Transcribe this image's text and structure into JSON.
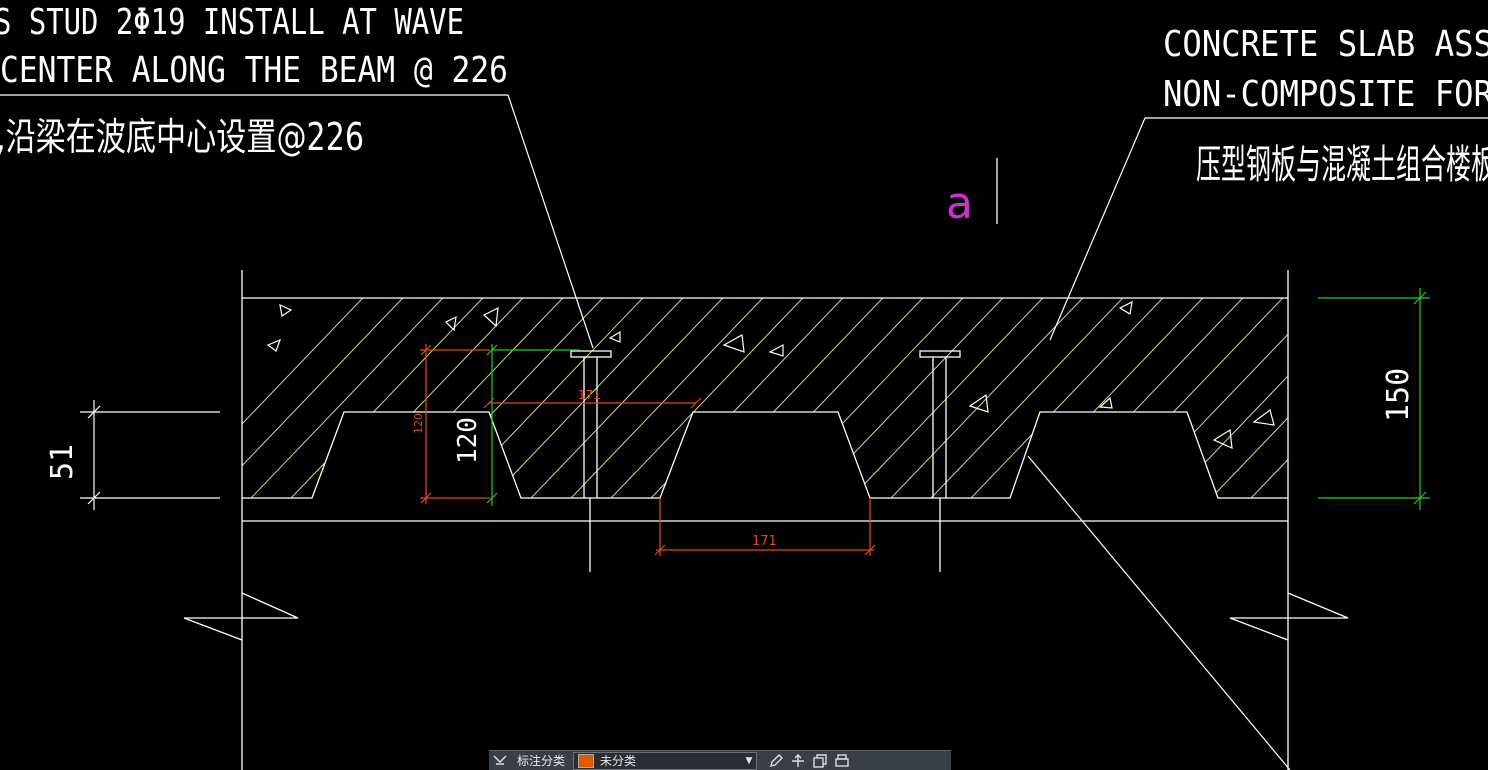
{
  "annotations": {
    "stud_en_line1": "S STUD 2Φ19 INSTALL AT WAVE",
    "stud_en_line2": "CENTER ALONG THE BEAM @ 226",
    "stud_cn": ",沿梁在波底中心设置@226",
    "slab_en_line1": "CONCRETE SLAB ASS",
    "slab_en_line2": "NON-COMPOSITE FOR",
    "slab_cn": "压型钢板与混凝土组合楼板",
    "cursor_text": "a"
  },
  "dimensions": {
    "left_height": "51",
    "right_height": "150",
    "rib_height_large": "120",
    "rib_height_small": "120",
    "top_rib_spacing": "171",
    "bottom_rib_width": "171"
  },
  "colors": {
    "background": "#000000",
    "line": "#ffffff",
    "hatch": "#c8e070",
    "dim_orange": "#e04a1a",
    "dim_green": "#22cc22",
    "magenta": "#cc33cc"
  },
  "toolbar": {
    "label": "标注分类",
    "selected_layer": "未分类",
    "icons": [
      "layer-icon",
      "edit-icon",
      "move-icon",
      "copy-icon",
      "print-icon"
    ]
  }
}
